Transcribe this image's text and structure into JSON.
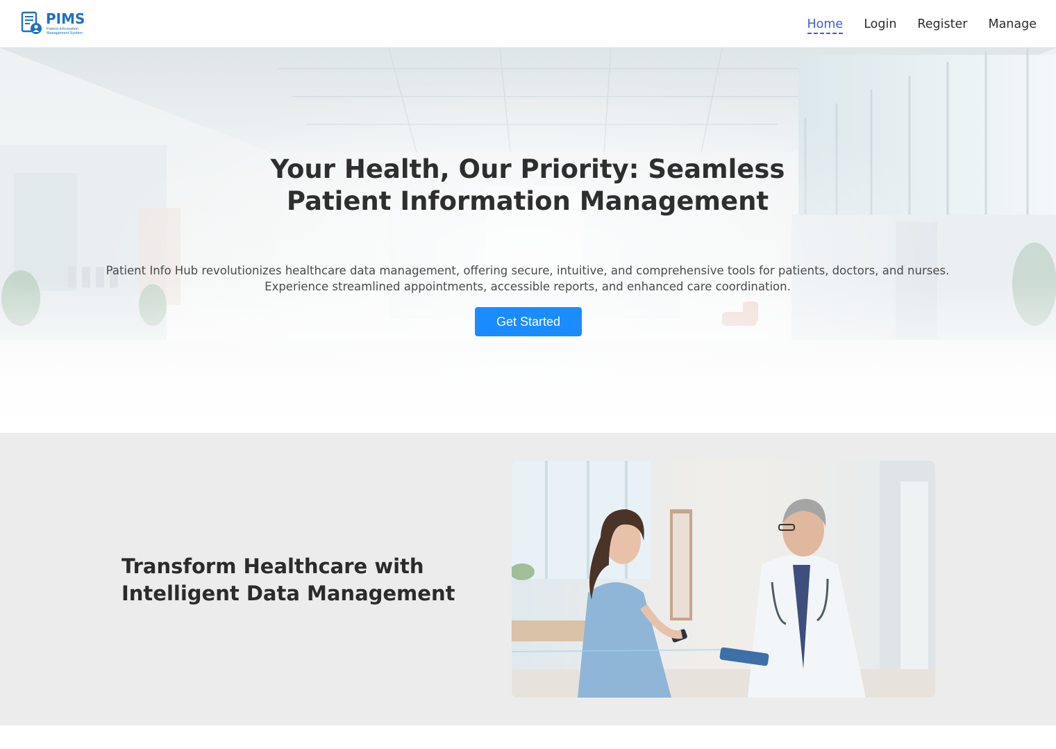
{
  "header": {
    "logo": {
      "title": "PIMS",
      "subtitle": "Patient Information Management System",
      "icon": "document-user-icon"
    },
    "nav": [
      {
        "label": "Home",
        "active": true
      },
      {
        "label": "Login",
        "active": false
      },
      {
        "label": "Register",
        "active": false
      },
      {
        "label": "Manage",
        "active": false
      }
    ]
  },
  "hero": {
    "title": "Your Health, Our Priority: Seamless Patient Information Management",
    "description": "Patient Info Hub revolutionizes healthcare data management, offering secure, intuitive, and comprehensive tools for patients, doctors, and nurses. Experience streamlined appointments, accessible reports, and enhanced care coordination.",
    "cta_label": "Get Started",
    "background": "hospital-hallway-photo"
  },
  "feature": {
    "title": "Transform Healthcare with Intelligent Data Management",
    "image": "doctor-and-nurse-with-tablet-photo"
  },
  "colors": {
    "brand": "#1e6fc4",
    "nav_active": "#3c5bd6",
    "cta": "#1a8cff",
    "feature_bg": "#ececec"
  }
}
